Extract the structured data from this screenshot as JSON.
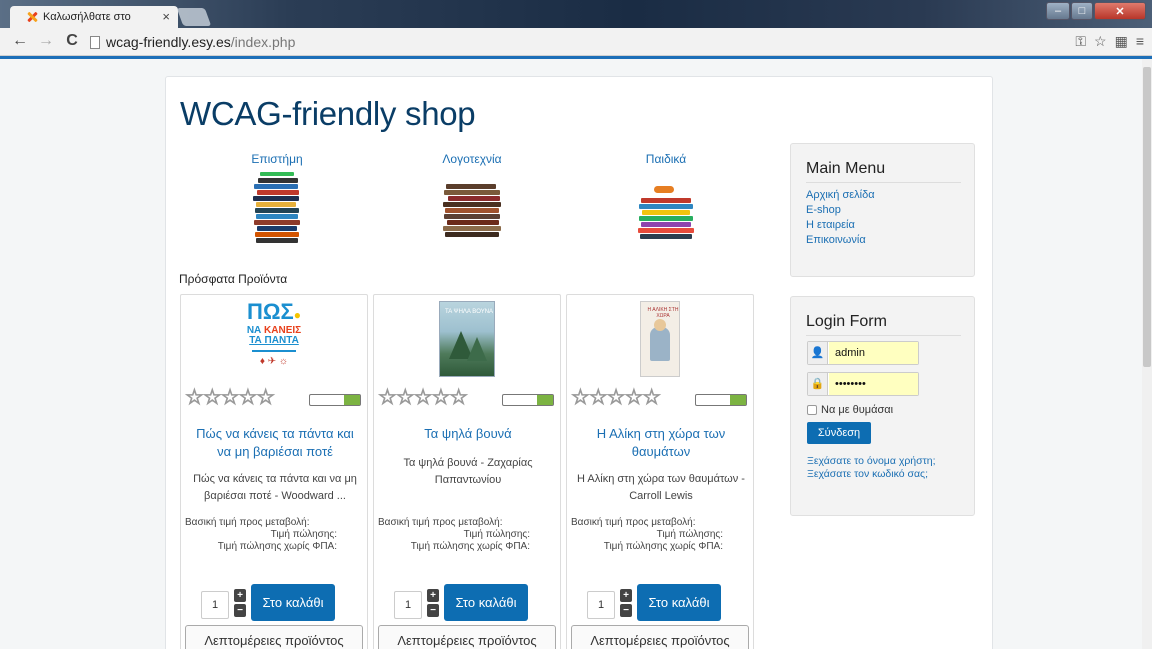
{
  "browser": {
    "tab_title": "Καλωσήλθατε στο",
    "tab_close": "×",
    "url_host": "wcag-friendly.esy.es",
    "url_path": "/index.php",
    "back_icon": "←",
    "forward_icon": "→",
    "reload_icon": "C",
    "win_min": "–",
    "win_max": "□",
    "win_close": "✕"
  },
  "site": {
    "title": "WCAG-friendly shop",
    "accent_color": "#0d6db2",
    "link_color": "#1b6fb3"
  },
  "categories": [
    {
      "label": "Επιστήμη",
      "icon": "book-stack-icon"
    },
    {
      "label": "Λογοτεχνία",
      "icon": "book-stack-icon"
    },
    {
      "label": "Παιδικά",
      "icon": "book-stack-icon"
    }
  ],
  "recent_heading": "Πρόσφατα Προϊόντα",
  "products": [
    {
      "title": "Πώς να κάνεις τα πάντα και να μη βαριέσαι ποτέ",
      "description": "Πώς να κάνεις τα πάντα και να μη βαριέσαι ποτέ - Woodward ...",
      "rating": "☆☆☆☆☆",
      "price_base": "Βασική τιμή προς μεταβολή:",
      "price_sale": "Τιμή πώλησης:",
      "price_no_vat": "Τιμή πώλησης χωρίς ΦΠΑ:",
      "qty": "1",
      "cart_label": "Στο καλάθι",
      "details_label": "Λεπτομέρειες προϊόντος"
    },
    {
      "title": "Τα ψηλά βουνά",
      "description": "Τα ψηλά βουνά - Ζαχαρίας Παπαντωνίου",
      "rating": "☆☆☆☆☆",
      "price_base": "Βασική τιμή προς μεταβολή:",
      "price_sale": "Τιμή πώλησης:",
      "price_no_vat": "Τιμή πώλησης χωρίς ΦΠΑ:",
      "qty": "1",
      "cart_label": "Στο καλάθι",
      "details_label": "Λεπτομέρειες προϊόντος"
    },
    {
      "title": "Η Αλίκη στη χώρα των θαυμάτων",
      "description": "Η Αλίκη στη χώρα των θαυμάτων - Carroll Lewis",
      "rating": "☆☆☆☆☆",
      "price_base": "Βασική τιμή προς μεταβολή:",
      "price_sale": "Τιμή πώλησης:",
      "price_no_vat": "Τιμή πώλησης χωρίς ΦΠΑ:",
      "qty": "1",
      "cart_label": "Στο καλάθι",
      "details_label": "Λεπτομέρειες προϊόντος"
    }
  ],
  "main_menu": {
    "title": "Main Menu",
    "items": [
      "Αρχική σελίδα",
      "E-shop",
      "Η εταιρεία",
      "Επικοινωνία"
    ]
  },
  "login": {
    "title": "Login Form",
    "username": "admin",
    "password": "••••••••",
    "remember": "Να με θυμάσαι",
    "submit": "Σύνδεση",
    "forgot_user": "Ξεχάσατε το όνομα χρήστη;",
    "forgot_pass": "Ξεχάσατε τον κωδικό σας;"
  }
}
